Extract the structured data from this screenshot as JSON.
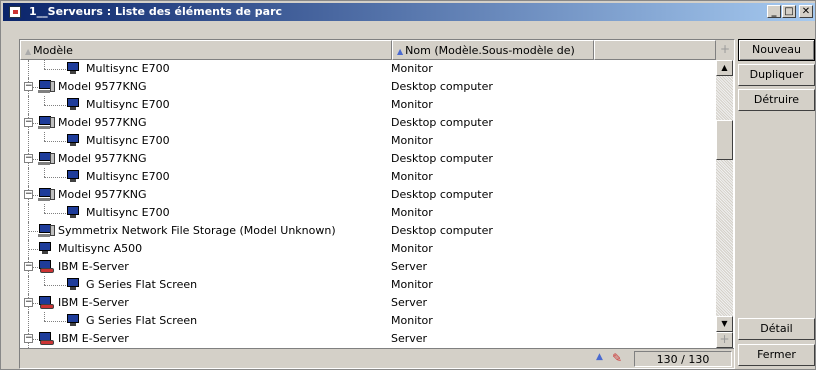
{
  "window": {
    "title": "1__Serveurs : Liste des éléments de parc",
    "minimize": "_",
    "maximize": "□",
    "close": "✕"
  },
  "grid": {
    "columns": [
      "Modèle",
      "Nom (Modèle.Sous-modèle de)"
    ],
    "rows": [
      {
        "model": "Multisync E700",
        "type": "Monitor",
        "level": 1,
        "icon": "monitor-icon"
      },
      {
        "model": "Model 9577KNG",
        "type": "Desktop computer",
        "level": 0,
        "icon": "desktop-computer-icon",
        "expander": "−"
      },
      {
        "model": "Multisync E700",
        "type": "Monitor",
        "level": 1,
        "icon": "monitor-icon"
      },
      {
        "model": "Model 9577KNG",
        "type": "Desktop computer",
        "level": 0,
        "icon": "desktop-computer-icon",
        "expander": "−"
      },
      {
        "model": "Multisync E700",
        "type": "Monitor",
        "level": 1,
        "icon": "monitor-icon"
      },
      {
        "model": "Model 9577KNG",
        "type": "Desktop computer",
        "level": 0,
        "icon": "desktop-computer-icon",
        "expander": "−"
      },
      {
        "model": "Multisync E700",
        "type": "Monitor",
        "level": 1,
        "icon": "monitor-icon"
      },
      {
        "model": "Model 9577KNG",
        "type": "Desktop computer",
        "level": 0,
        "icon": "desktop-computer-icon",
        "expander": "−"
      },
      {
        "model": "Multisync E700",
        "type": "Monitor",
        "level": 1,
        "icon": "monitor-icon"
      },
      {
        "model": "Symmetrix Network File Storage (Model Unknown)",
        "type": "Desktop computer",
        "level": 0,
        "icon": "desktop-computer-icon"
      },
      {
        "model": "Multisync A500",
        "type": "Monitor",
        "level": 0,
        "icon": "monitor-icon"
      },
      {
        "model": "IBM E-Server",
        "type": "Server",
        "level": 0,
        "icon": "server-icon",
        "expander": "−"
      },
      {
        "model": "G Series Flat Screen",
        "type": "Monitor",
        "level": 1,
        "icon": "monitor-icon"
      },
      {
        "model": "IBM E-Server",
        "type": "Server",
        "level": 0,
        "icon": "server-icon",
        "expander": "−"
      },
      {
        "model": "G Series Flat Screen",
        "type": "Monitor",
        "level": 1,
        "icon": "monitor-icon"
      },
      {
        "model": "IBM E-Server",
        "type": "Server",
        "level": 0,
        "icon": "server-icon",
        "expander": "−"
      }
    ],
    "record_count": "130 / 130"
  },
  "buttons": {
    "new": "Nouveau",
    "duplicate": "Dupliquer",
    "destroy": "Détruire",
    "detail": "Détail",
    "close": "Fermer"
  },
  "colors": {
    "title_start": "#0a246a",
    "title_end": "#a6caf0",
    "face": "#d4d0c8"
  }
}
